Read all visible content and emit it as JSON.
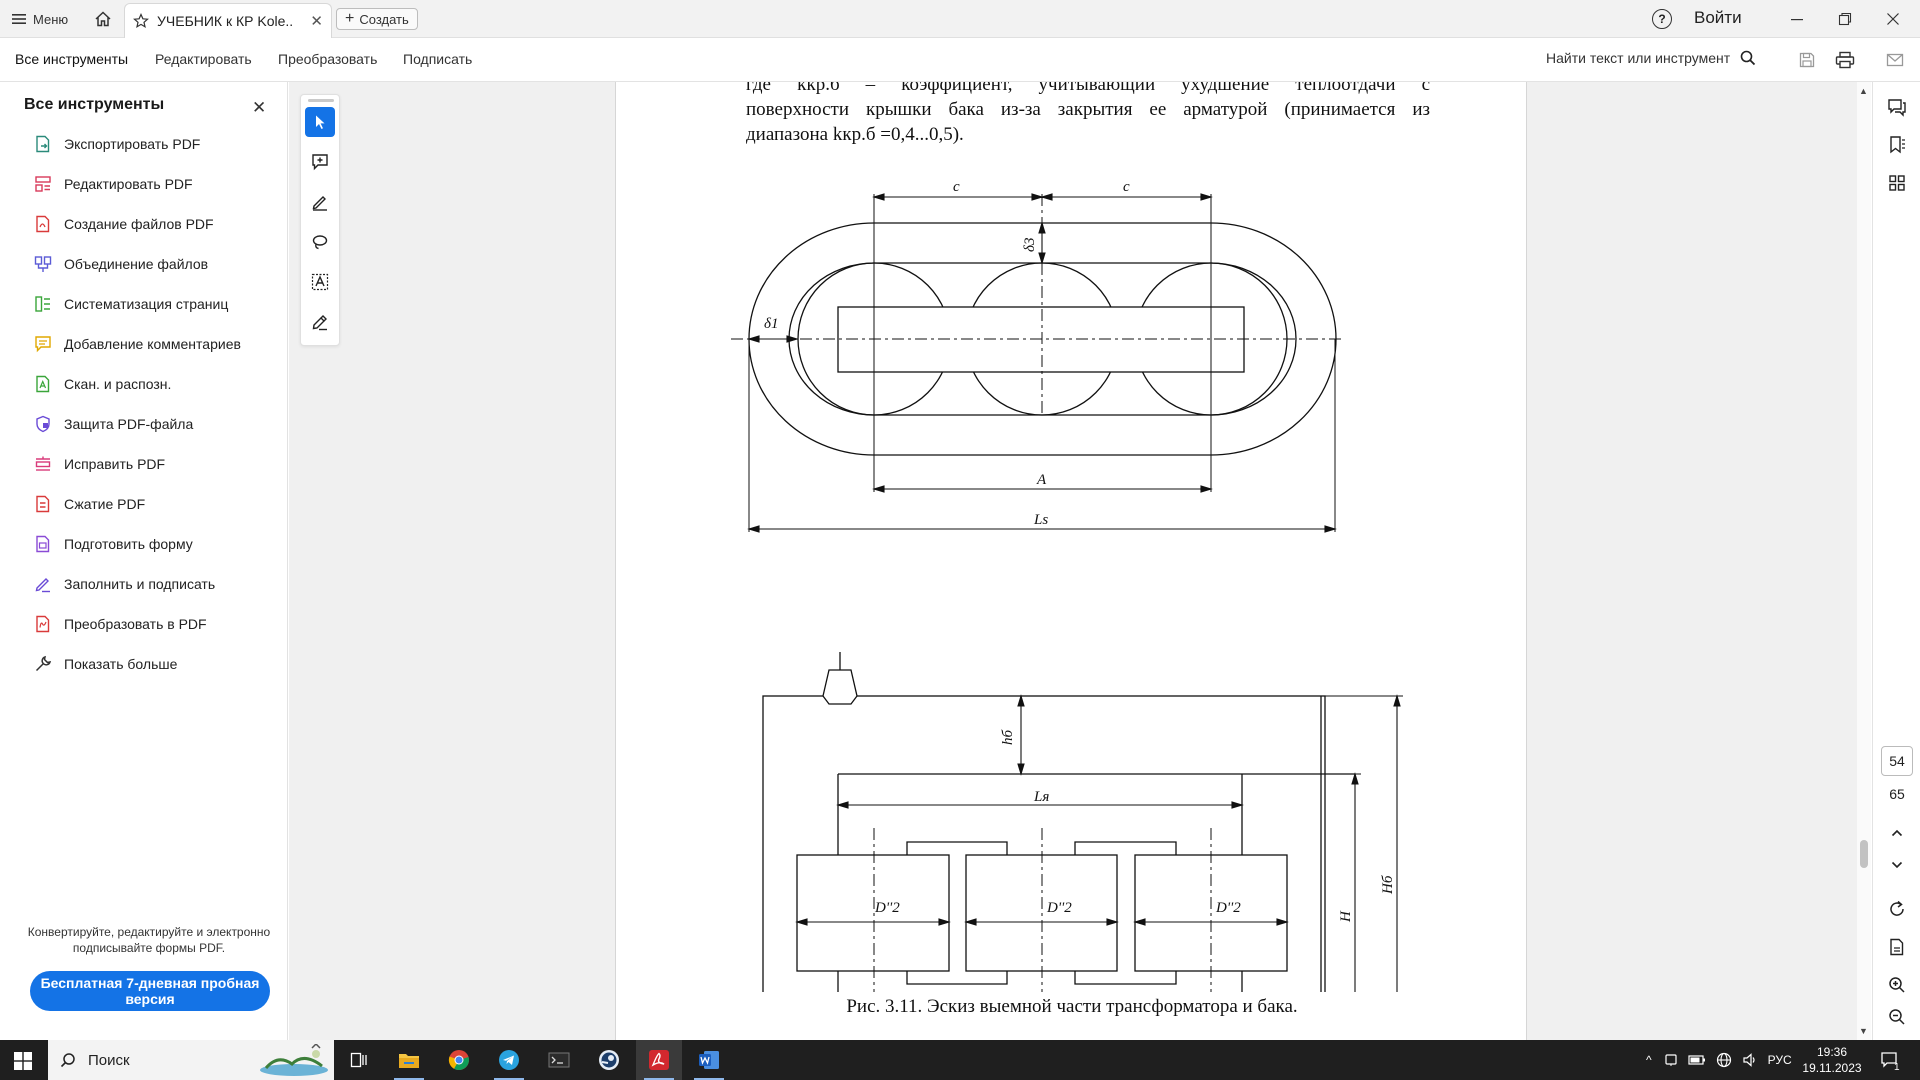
{
  "titlebar": {
    "menu_label": "Меню",
    "tab_title": "УЧЕБНИК к КР Kole...",
    "create_label": "Создать",
    "help_glyph": "?",
    "login_label": "Войти"
  },
  "toolbar": {
    "tabs": [
      "Все инструменты",
      "Редактировать",
      "Преобразовать",
      "Подписать"
    ],
    "find_label": "Найти текст или инструмент"
  },
  "left_panel": {
    "title": "Все инструменты",
    "items": [
      {
        "label": "Экспортировать PDF",
        "icon": "export-pdf-icon",
        "color": "#2a8a7a"
      },
      {
        "label": "Редактировать PDF",
        "icon": "edit-pdf-icon",
        "color": "#d93a5a"
      },
      {
        "label": "Создание файлов PDF",
        "icon": "create-pdf-icon",
        "color": "#d93a3a"
      },
      {
        "label": "Объединение файлов",
        "icon": "combine-files-icon",
        "color": "#5b5bd6"
      },
      {
        "label": "Систематизация страниц",
        "icon": "organize-pages-icon",
        "color": "#3aa53a"
      },
      {
        "label": "Добавление комментариев",
        "icon": "comment-icon",
        "color": "#e0a800"
      },
      {
        "label": "Скан. и распозн.",
        "icon": "scan-ocr-icon",
        "color": "#3aa53a"
      },
      {
        "label": "Защита PDF-файла",
        "icon": "protect-icon",
        "color": "#6a4bd6"
      },
      {
        "label": "Исправить PDF",
        "icon": "redact-icon",
        "color": "#d93a7a"
      },
      {
        "label": "Сжатие PDF",
        "icon": "compress-icon",
        "color": "#d93a3a"
      },
      {
        "label": "Подготовить форму",
        "icon": "prepare-form-icon",
        "color": "#8a4bd6"
      },
      {
        "label": "Заполнить и подписать",
        "icon": "fill-sign-icon",
        "color": "#6a4bd6"
      },
      {
        "label": "Преобразовать в PDF",
        "icon": "convert-pdf-icon",
        "color": "#d93a3a"
      },
      {
        "label": "Показать больше",
        "icon": "tools-more-icon",
        "color": "#333333"
      }
    ],
    "footer_text": "Конвертируйте, редактируйте и электронно подписывайте формы PDF.",
    "trial_label": "Бесплатная 7-дневная пробная версия"
  },
  "document": {
    "line1": "где  kкр.б  –  коэффициент,  учитывающий  ухудшение  теплоотдачи  с",
    "line2": "поверхности крышки бака из-за закрытия ее арматурой (принимается из",
    "line3": "диапазона kкр.б =0,4...0,5).",
    "drawing1_labels": {
      "c1": "c",
      "c2": "c",
      "delta3": "δ3",
      "delta1": "δ1",
      "A": "A",
      "Ls": "Ls"
    },
    "drawing2_labels": {
      "hb": "hб",
      "Ly": "Lя",
      "D1": "D''2",
      "D2": "D''2",
      "D3": "D''2",
      "H": "H",
      "Hb": "Hб"
    },
    "caption": "Рис. 3.11. Эскиз выемной части трансформатора и бака."
  },
  "navigation": {
    "current_page": "54",
    "total_pages": "65"
  },
  "taskbar": {
    "search_label": "Поиск",
    "lang": "РУС",
    "time": "19:36",
    "date": "19.11.2023",
    "notif_count": "1"
  },
  "colors": {
    "accent": "#1473e6",
    "taskbar": "#1f1f1f"
  }
}
